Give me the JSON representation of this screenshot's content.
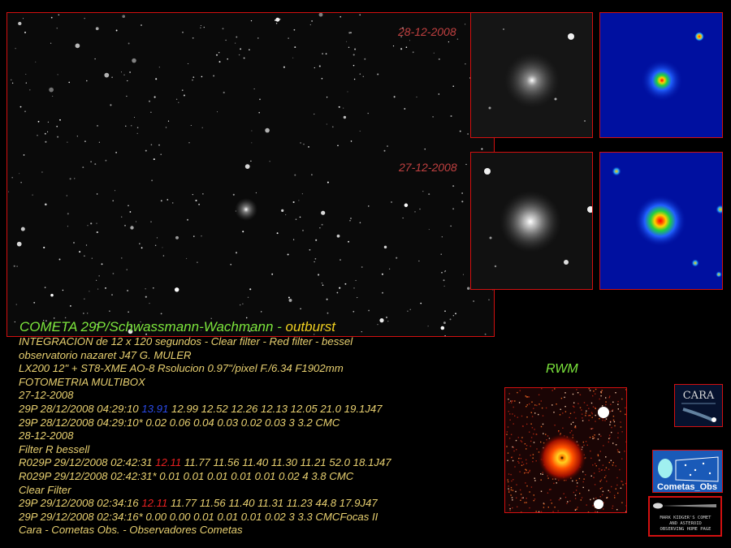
{
  "title": {
    "main": "COMETA  29P/Schwassmann-Wachmann - ",
    "suffix": "outburst"
  },
  "dates": {
    "top": "28-12-2008",
    "bottom": "27-12-2008"
  },
  "info_lines": [
    {
      "text": "INTEGRACION de 12 x 120 segundos - Clear filter - Red filter - bessel"
    },
    {
      "text": "observatorio nazaret J47  G. MULER"
    },
    {
      "text": "LX200 12\" +  ST8-XME AO-8  Rsolucion 0.97\"/pixel   F./6.34   F1902mm"
    },
    {
      "text": "FOTOMETRIA MULTIBOX"
    },
    {
      "text": "27-12-2008"
    },
    {
      "pre": "29P 28/12/2008 04:29:10 ",
      "hl": "13.91",
      "hl_color": "blue",
      "post": " 12.99 12.52 12.26 12.13 12.05 21.0 19.1J47"
    },
    {
      "text": "29P 28/12/2008 04:29:10* 0.02 0.06 0.04 0.03 0.02 0.03 3 3.2 CMC"
    },
    {
      "text": "28-12-2008"
    },
    {
      "text": "Filter R bessell"
    },
    {
      "pre": "R029P 29/12/2008 02:42:31 ",
      "hl": "12.11",
      "hl_color": "red",
      "post": " 11.77 11.56 11.40 11.30 11.21 52.0 18.1J47"
    },
    {
      "text": "R029P 29/12/2008 02:42:31* 0.01 0.01 0.01 0.01 0.01 0.02 4 3.8 CMC"
    },
    {
      "text": "Clear Filter"
    },
    {
      "pre": "29P 29/12/2008 02:34:16 ",
      "hl": "12.11",
      "hl_color": "red",
      "post": " 11.77 11.56 11.40 11.31 11.23 44.8 17.9J47"
    },
    {
      "text": "29P 29/12/2008 02:34:16* 0.00 0.00 0.01 0.01 0.01 0.02 3 3.3 CMCFocas II"
    },
    {
      "text": "Cara - Cometas Obs. - Observadores Cometas"
    }
  ],
  "rwm_label": "RWM",
  "logos": {
    "cara": "CARA",
    "cometas_obs": "Cometas_Obs",
    "kidger_lines": [
      "MARK KIDGER'S COMET",
      "AND ASTEROID",
      "OBSERVING HOME PAGE"
    ]
  },
  "colors": {
    "frame_red": "#d21010",
    "title_green": "#7ce63c",
    "title_yellow": "#f0d020",
    "info_text": "#e8d070",
    "date_label": "#c04040"
  }
}
